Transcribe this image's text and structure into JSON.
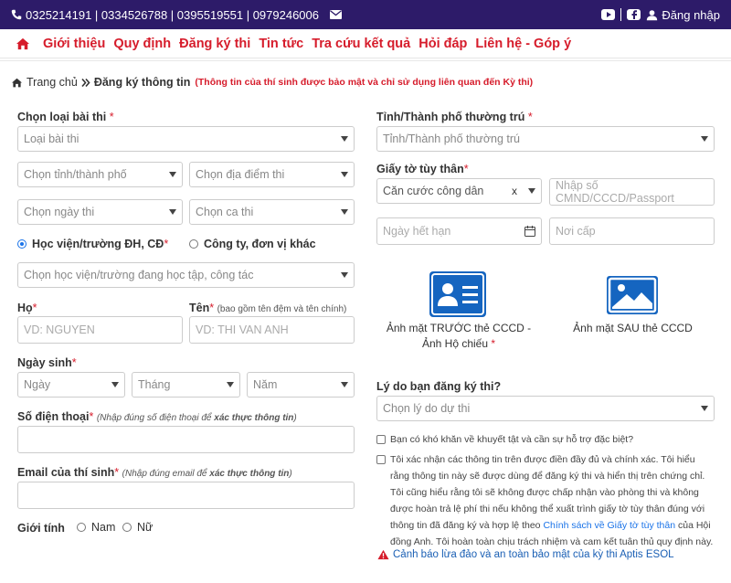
{
  "topbar": {
    "phones": "0325214191 | 0334526788 | 0395519551 | 0979246006",
    "login_label": "Đăng nhập"
  },
  "nav": {
    "items": [
      "Giới thiệu",
      "Quy định",
      "Đăng ký thi",
      "Tin tức",
      "Tra cứu kết quả",
      "Hỏi đáp",
      "Liên hệ - Góp ý"
    ]
  },
  "breadcrumb": {
    "home": "Trang chủ",
    "current": "Đăng ký thông tin",
    "note": "(Thông tin của thí sinh được bảo mật và chỉ sử dụng liên quan đến Kỳ thi)"
  },
  "form": {
    "exam_type_label": "Chọn loại bài thi",
    "exam_type_placeholder": "Loại bài thi",
    "city_placeholder": "Chọn tỉnh/thành phố",
    "venue_placeholder": "Chọn địa điểm thi",
    "date_placeholder": "Chọn ngày thi",
    "shift_placeholder": "Chọn ca thi",
    "radio_school": "Học viện/trường ĐH, CĐ",
    "radio_company": "Công ty, đơn vị khác",
    "school_placeholder": "Chọn học viện/trường đang học tập, công tác",
    "surname_label": "Họ",
    "surname_placeholder": "VD: NGUYEN",
    "name_label": "Tên",
    "name_hint": "(bao gồm tên đệm và tên chính)",
    "name_placeholder": "VD: THI VAN ANH",
    "dob_label": "Ngày sinh",
    "dob_day": "Ngày",
    "dob_month": "Tháng",
    "dob_year": "Năm",
    "phone_label": "Số điện thoại",
    "phone_hint_pre": "(Nhập đúng số điện thoại để ",
    "phone_hint_bold": "xác thực thông tin",
    "phone_hint_post": ")",
    "email_label": "Email của thí sinh",
    "email_hint_pre": "(Nhập đúng email để ",
    "email_hint_bold": "xác thực thông tin",
    "email_hint_post": ")",
    "gender_label": "Giới tính",
    "gender_male": "Nam",
    "gender_female": "Nữ",
    "province_label": "Tỉnh/Thành phố thường trú",
    "province_placeholder": "Tỉnh/Thành phố thường trú",
    "id_label": "Giấy tờ tùy thân",
    "id_type_value": "Căn cước công dân",
    "id_number_placeholder": "Nhập số CMND/CCCD/Passport",
    "expiry_placeholder": "Ngày hết hạn",
    "issue_place_placeholder": "Nơi cấp",
    "front_caption": "Ảnh mặt TRƯỚC thẻ CCCD - Ảnh Hộ chiếu",
    "back_caption": "Ảnh mặt SAU thẻ CCCD",
    "reason_label": "Lý do bạn đăng ký thi?",
    "reason_placeholder": "Chọn lý do dự thi",
    "support_check": "Bạn có khó khăn về khuyết tật và cần sự hỗ trợ đặc biệt?",
    "confirm_text": "Tôi xác nhận các thông tin trên được điền đầy đủ và chính xác. Tôi hiểu rằng thông tin này sẽ được dùng để đăng ký thi và hiển thị trên chứng chỉ. Tôi cũng hiểu rằng tôi sẽ không được chấp nhận vào phòng thi và không được hoàn trả lệ phí thi nếu không thể xuất trình giấy tờ tùy thân đúng với thông tin đã đăng ký và hợp lệ theo",
    "confirm_link": "Chính sách về Giấy tờ tùy thân",
    "confirm_tail": "của Hội đồng Anh. Tôi hoàn toàn chịu trách nhiệm và cam kết tuân thủ quy định này.",
    "warning_link": "Cảnh báo lừa đảo và an toàn bảo mật của kỳ thi Aptis ESOL",
    "required_mark": "*"
  },
  "colors": {
    "topbar_bg": "#2d1b69",
    "nav_red": "#d61c2b",
    "icon_blue": "#1565c0",
    "link_blue": "#1a5fb4"
  }
}
